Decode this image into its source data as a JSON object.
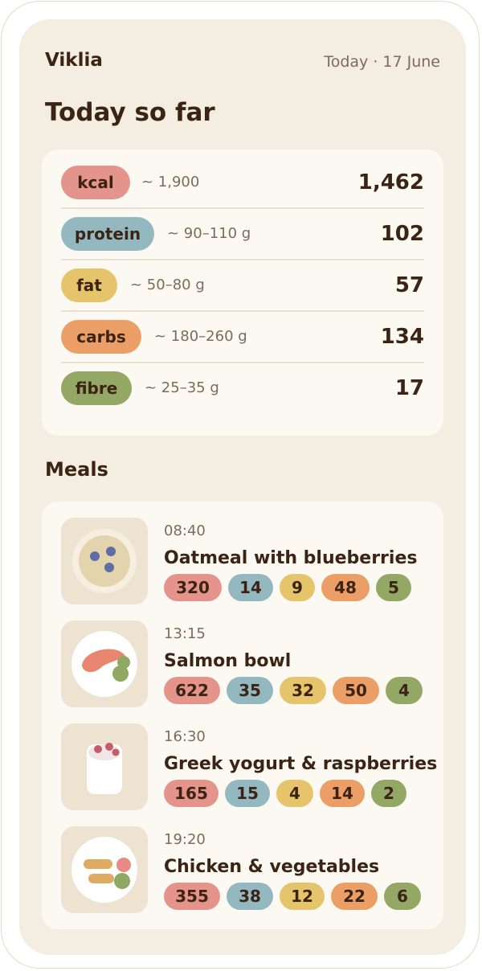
{
  "header": {
    "app_name": "Viklia",
    "date": "Today · 17 June"
  },
  "summary": {
    "title": "Today so far",
    "rows": [
      {
        "label": "kcal",
        "target": "~ 1,900",
        "value": "1,462",
        "color": "#e5948c"
      },
      {
        "label": "protein",
        "target": "~ 90–110 g",
        "value": "102",
        "color": "#93b8c0"
      },
      {
        "label": "fat",
        "target": "~ 50–80 g",
        "value": "57",
        "color": "#e6c46b"
      },
      {
        "label": "carbs",
        "target": "~ 180–260 g",
        "value": "134",
        "color": "#eb9f66"
      },
      {
        "label": "fibre",
        "target": "~ 25–35 g",
        "value": "17",
        "color": "#93a865"
      }
    ]
  },
  "meals": {
    "title": "Meals",
    "items": [
      {
        "time": "08:40",
        "name": "Oatmeal with blueberries",
        "icon": "oatmeal-bowl-icon",
        "kcal": "320",
        "protein": "14",
        "fat": "9",
        "carbs": "48",
        "fibre": "5"
      },
      {
        "time": "13:15",
        "name": "Salmon bowl",
        "icon": "salmon-plate-icon",
        "kcal": "622",
        "protein": "35",
        "fat": "32",
        "carbs": "50",
        "fibre": "4"
      },
      {
        "time": "16:30",
        "name": "Greek yogurt & raspberries",
        "icon": "yogurt-cup-icon",
        "kcal": "165",
        "protein": "15",
        "fat": "4",
        "carbs": "14",
        "fibre": "2"
      },
      {
        "time": "19:20",
        "name": "Chicken & vegetables",
        "icon": "chicken-plate-icon",
        "kcal": "355",
        "protein": "38",
        "fat": "12",
        "carbs": "22",
        "fibre": "6"
      }
    ]
  }
}
